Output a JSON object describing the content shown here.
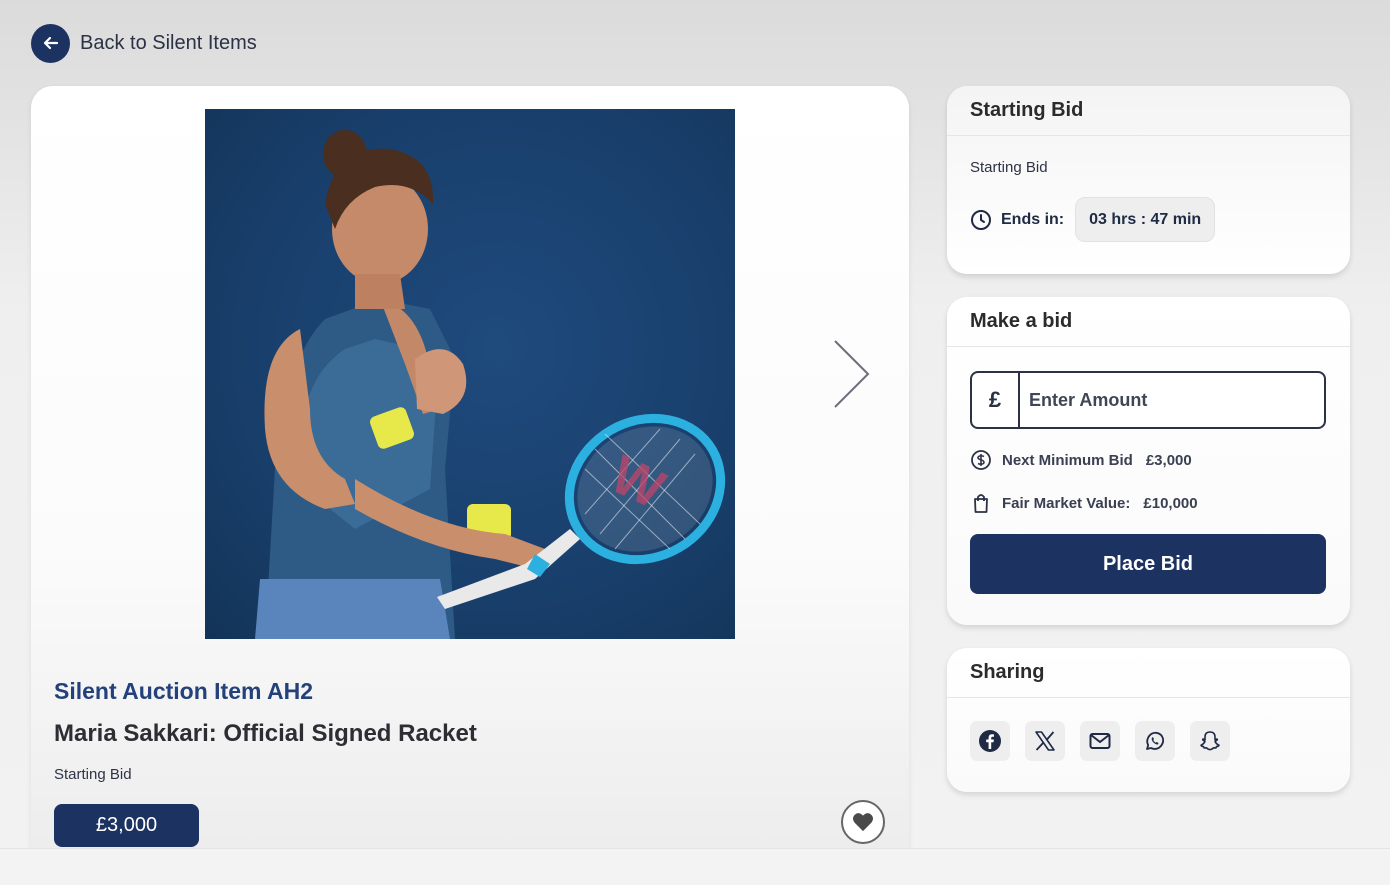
{
  "nav": {
    "back_label": "Back to Silent Items"
  },
  "item": {
    "code": "Silent Auction Item AH2",
    "title": "Maria Sakkari: Official Signed Racket",
    "starting_label": "Starting Bid",
    "starting_price": "£3,000",
    "photo_icon": "tennis-player-photo",
    "next_icon": "chevron-right-icon",
    "favorite_icon": "heart-icon"
  },
  "bid_panel": {
    "header": "Starting Bid",
    "subtitle": "Starting Bid",
    "ends_label": "Ends in:",
    "countdown": "03 hrs : 47 min",
    "clock_icon": "clock-icon"
  },
  "make_bid": {
    "header": "Make a bid",
    "currency_symbol": "£",
    "amount_placeholder": "Enter Amount",
    "amount_value": "",
    "min_bid_label": "Next Minimum Bid",
    "min_bid_value": "£3,000",
    "fmv_label": "Fair Market Value:",
    "fmv_value": "£10,000",
    "place_bid_label": "Place Bid"
  },
  "sharing": {
    "header": "Sharing",
    "icons": [
      "facebook-icon",
      "x-icon",
      "mail-icon",
      "whatsapp-icon",
      "snapchat-icon"
    ]
  },
  "colors": {
    "brand_navy": "#1c3261",
    "title_blue": "#23417a",
    "photo_bg": "#19406d"
  }
}
